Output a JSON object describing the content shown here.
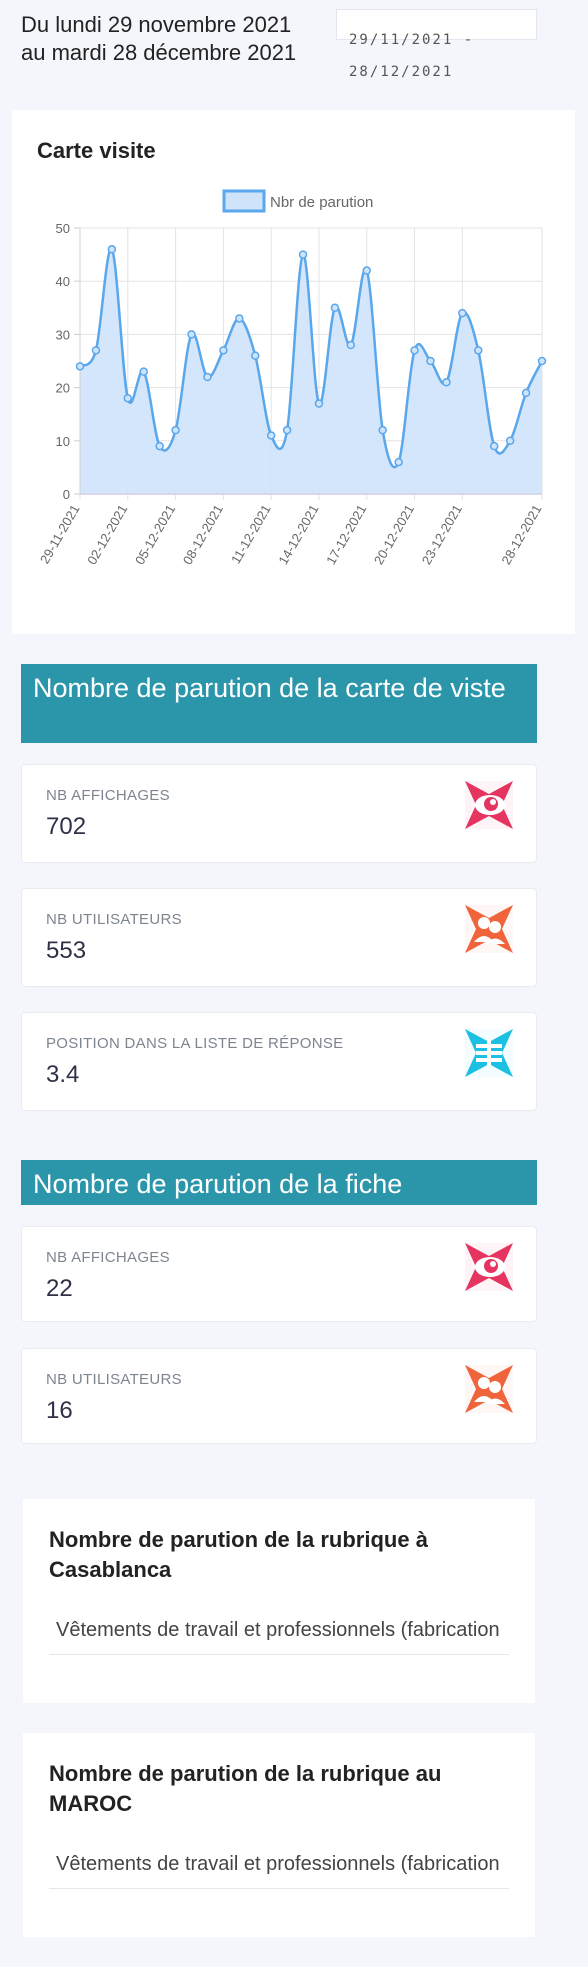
{
  "header": {
    "period": "Du lundi 29 novembre 2021 au mardi 28 décembre 2021",
    "date_range": "29/11/2021 - 28/12/2021"
  },
  "chart_card": {
    "title": "Carte visite"
  },
  "chart_data": {
    "type": "area",
    "title": "Carte visite",
    "legend": [
      "Nbr de parution"
    ],
    "legend_position": "top",
    "series": [
      {
        "name": "Nbr de parution",
        "values": [
          24,
          27,
          46,
          18,
          23,
          9,
          12,
          30,
          22,
          27,
          33,
          26,
          11,
          12,
          45,
          17,
          35,
          28,
          42,
          12,
          6,
          27,
          25,
          21,
          34,
          27,
          9,
          10,
          19,
          25
        ]
      }
    ],
    "x": [
      "29-11-2021",
      "30-11-2021",
      "01-12-2021",
      "02-12-2021",
      "03-12-2021",
      "04-12-2021",
      "05-12-2021",
      "06-12-2021",
      "07-12-2021",
      "08-12-2021",
      "09-12-2021",
      "10-12-2021",
      "11-12-2021",
      "12-12-2021",
      "13-12-2021",
      "14-12-2021",
      "15-12-2021",
      "16-12-2021",
      "17-12-2021",
      "18-12-2021",
      "19-12-2021",
      "20-12-2021",
      "21-12-2021",
      "22-12-2021",
      "23-12-2021",
      "24-12-2021",
      "25-12-2021",
      "26-12-2021",
      "27-12-2021",
      "28-12-2021"
    ],
    "x_tick_labels": [
      "29-11-2021",
      "02-12-2021",
      "05-12-2021",
      "08-12-2021",
      "11-12-2021",
      "14-12-2021",
      "17-12-2021",
      "20-12-2021",
      "23-12-2021",
      "28-12-2021"
    ],
    "y_ticks": [
      "0",
      "10",
      "20",
      "30",
      "40",
      "50"
    ],
    "ylim": [
      0,
      50
    ],
    "grid": true,
    "line_color": "#5aa7ec",
    "fill_color": "#cfe3fb"
  },
  "sections": [
    {
      "title": "Nombre de parution de la carte de viste",
      "stats": [
        {
          "label": "NB AFFICHAGES",
          "value": "702",
          "icon": "eye-icon",
          "color": "#e5345f"
        },
        {
          "label": "NB UTILISATEURS",
          "value": "553",
          "icon": "users-icon",
          "color": "#f0643c"
        },
        {
          "label": "POSITION DANS LA LISTE DE RÉPONSE",
          "value": "3.4",
          "icon": "list-position-icon",
          "color": "#1bc0e3"
        }
      ]
    },
    {
      "title": "Nombre de parution de la fiche",
      "stats": [
        {
          "label": "NB AFFICHAGES",
          "value": "22",
          "icon": "eye-icon",
          "color": "#e5345f"
        },
        {
          "label": "NB UTILISATEURS",
          "value": "16",
          "icon": "users-icon",
          "color": "#f0643c"
        }
      ]
    }
  ],
  "rubrics": [
    {
      "title": "Nombre de parution de la rubrique à Casablanca",
      "item": "Vêtements de travail et professionnels (fabrication"
    },
    {
      "title": "Nombre de parution de la rubrique au MAROC",
      "item": "Vêtements de travail et professionnels (fabrication"
    }
  ],
  "colors": {
    "banner": "#2b96aa",
    "page_background": "#f4f6fc"
  }
}
